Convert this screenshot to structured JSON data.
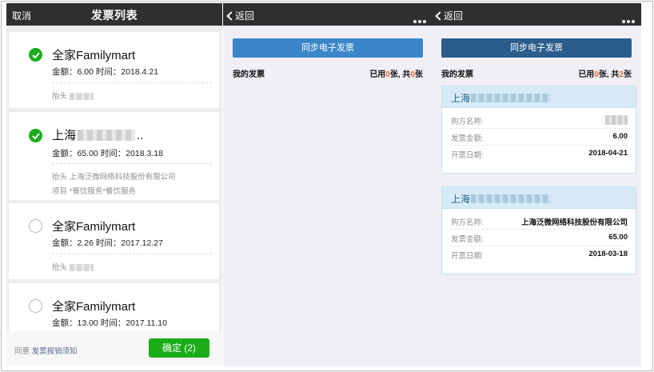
{
  "panel1": {
    "cancel_label": "取消",
    "title": "发票列表",
    "cards": [
      {
        "name": "全家Familymart",
        "amount_text": "金额：6.00 时间：2018.4.21",
        "note1": "抬头",
        "checked": true
      },
      {
        "name_prefix": "上海",
        "name_suffix": "..",
        "amount_text": "金额：65.00 时间：2018.3.18",
        "note1": "抬头 上海泛微网络科技股份有限公司",
        "note2": "项目 *餐饮服务*餐饮服务",
        "checked": true
      },
      {
        "name": "全家Familymart",
        "amount_text": "金额：2.26 时间：2017.12.27",
        "note1": "抬头",
        "checked": false
      },
      {
        "name": "全家Familymart",
        "amount_text": "金额：13.00 时间：2017.11.10",
        "checked": false
      }
    ],
    "agree_prefix": "同意",
    "agree_link": "发票报销须知",
    "confirm_label": "确定 (2)"
  },
  "panel2": {
    "back_label": "返回",
    "sync_label": "同步电子发票",
    "my_label": "我的发票",
    "count": {
      "prefix": "已用",
      "used": "0",
      "mid": "张, 共",
      "total": "0",
      "suffix": "张"
    }
  },
  "panel3": {
    "back_label": "返回",
    "sync_label": "同步电子发票",
    "my_label": "我的发票",
    "count": {
      "prefix": "已用",
      "used": "0",
      "mid": "张, 共",
      "total": "2",
      "suffix": "张"
    },
    "invoices": [
      {
        "title": "上海",
        "buyer_label": "购方名称:",
        "buyer": "",
        "amount_label": "发票金额:",
        "amount": "6.00",
        "date_label": "开票日期:",
        "date": "2018-04-21"
      },
      {
        "title": "上海",
        "buyer_label": "购方名称:",
        "buyer": "上海泛微网络科技股份有限公司",
        "amount_label": "发票金额:",
        "amount": "65.00",
        "date_label": "开票日期:",
        "date": "2018-03-18"
      }
    ]
  },
  "colors": {
    "green": "#1aad19",
    "orange": "#f0652e",
    "link": "#576b95"
  }
}
